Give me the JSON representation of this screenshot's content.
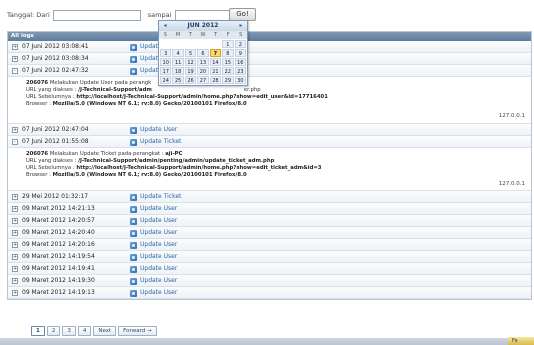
{
  "filter": {
    "from_label": "Tanggal: Dari",
    "to_label": "sampai",
    "go_label": "Go!"
  },
  "table": {
    "header": "All logs",
    "rows_top": [
      {
        "exp": "+",
        "date": "07 Juni 2012 03:08:41",
        "action": "Update"
      },
      {
        "exp": "+",
        "date": "07 Juni 2012 03:08:34",
        "action": "Update"
      },
      {
        "exp": "-",
        "date": "07 Juni 2012 02:47:32",
        "action": "Update"
      }
    ],
    "detail1": {
      "l1_id": "206076",
      "l1_text": "Melakukan Update User pada perangk",
      "l2_label": "URL yang diakses :",
      "l2_val": "/J-Technical-Support/adm",
      "l2_tail": "er.php",
      "l3_label": "URL Sebelumnya :",
      "l3_val": "http://localhost/J-Technical-Support/admin/home.php?show=edit_user&id=17716401",
      "l4_label": "Browser :",
      "l4_val": "Mozilla/5.0 (Windows NT 6.1; rv:8.0) Gecko/20100101 Firefox/8.0",
      "ip": "127.0.0.1"
    },
    "rows_mid": [
      {
        "exp": "+",
        "date": "07 Juni 2012 02:47:04",
        "action": "Update User"
      },
      {
        "exp": "-",
        "date": "07 Juni 2012 01:55:08",
        "action": "Update Ticket"
      }
    ],
    "detail2": {
      "l1_id": "206076",
      "l1_text": "Melakukan Update Ticket pada perangkat :",
      "l1_host": "aji-PC",
      "l2_label": "URL yang diakses :",
      "l2_val": "/J-Technical-Support/admin/penting/admin/update_ticket_adm.php",
      "l3_label": "URL Sebelumnya :",
      "l3_val": "http://localhost/J-Technical-Support/admin/home.php?show=edit_ticket_adm&id=3",
      "l4_label": "Browser :",
      "l4_val": "Mozilla/5.0 (Windows NT 6.1; rv:8.0) Gecko/20100101 Firefox/8.0",
      "ip": "127.0.0.1"
    },
    "rows_bottom": [
      {
        "exp": "+",
        "date": "29 Mei 2012 01:32:17",
        "action": "Update Ticket"
      },
      {
        "exp": "+",
        "date": "09 Maret 2012 14:21:13",
        "action": "Update User"
      },
      {
        "exp": "+",
        "date": "09 Maret 2012 14:20:57",
        "action": "Update User"
      },
      {
        "exp": "+",
        "date": "09 Maret 2012 14:20:40",
        "action": "Update User"
      },
      {
        "exp": "+",
        "date": "09 Maret 2012 14:20:16",
        "action": "Update User"
      },
      {
        "exp": "+",
        "date": "09 Maret 2012 14:19:54",
        "action": "Update User"
      },
      {
        "exp": "+",
        "date": "09 Maret 2012 14:19:41",
        "action": "Update User"
      },
      {
        "exp": "+",
        "date": "09 Maret 2012 14:19:30",
        "action": "Update User"
      },
      {
        "exp": "+",
        "date": "09 Maret 2012 14:19:13",
        "action": "Update User"
      }
    ]
  },
  "pager": {
    "items": [
      "1",
      "2",
      "3",
      "4",
      "Next",
      "Forward →"
    ],
    "active": "1"
  },
  "calendar": {
    "title": "JUN 2012",
    "prev": "◂",
    "next": "▸",
    "dows": [
      "S",
      "M",
      "T",
      "W",
      "T",
      "F",
      "S"
    ],
    "days": [
      "",
      "",
      "",
      "",
      "",
      "1",
      "2",
      "3",
      "4",
      "5",
      "6",
      "7",
      "8",
      "9",
      "10",
      "11",
      "12",
      "13",
      "14",
      "15",
      "16",
      "17",
      "18",
      "19",
      "20",
      "21",
      "22",
      "23",
      "24",
      "25",
      "26",
      "27",
      "28",
      "29",
      "30"
    ],
    "today": "7"
  },
  "tray": {
    "label": "Fe"
  },
  "icons": {
    "row_action": "user-update-icon",
    "expand": "expand-icon"
  }
}
